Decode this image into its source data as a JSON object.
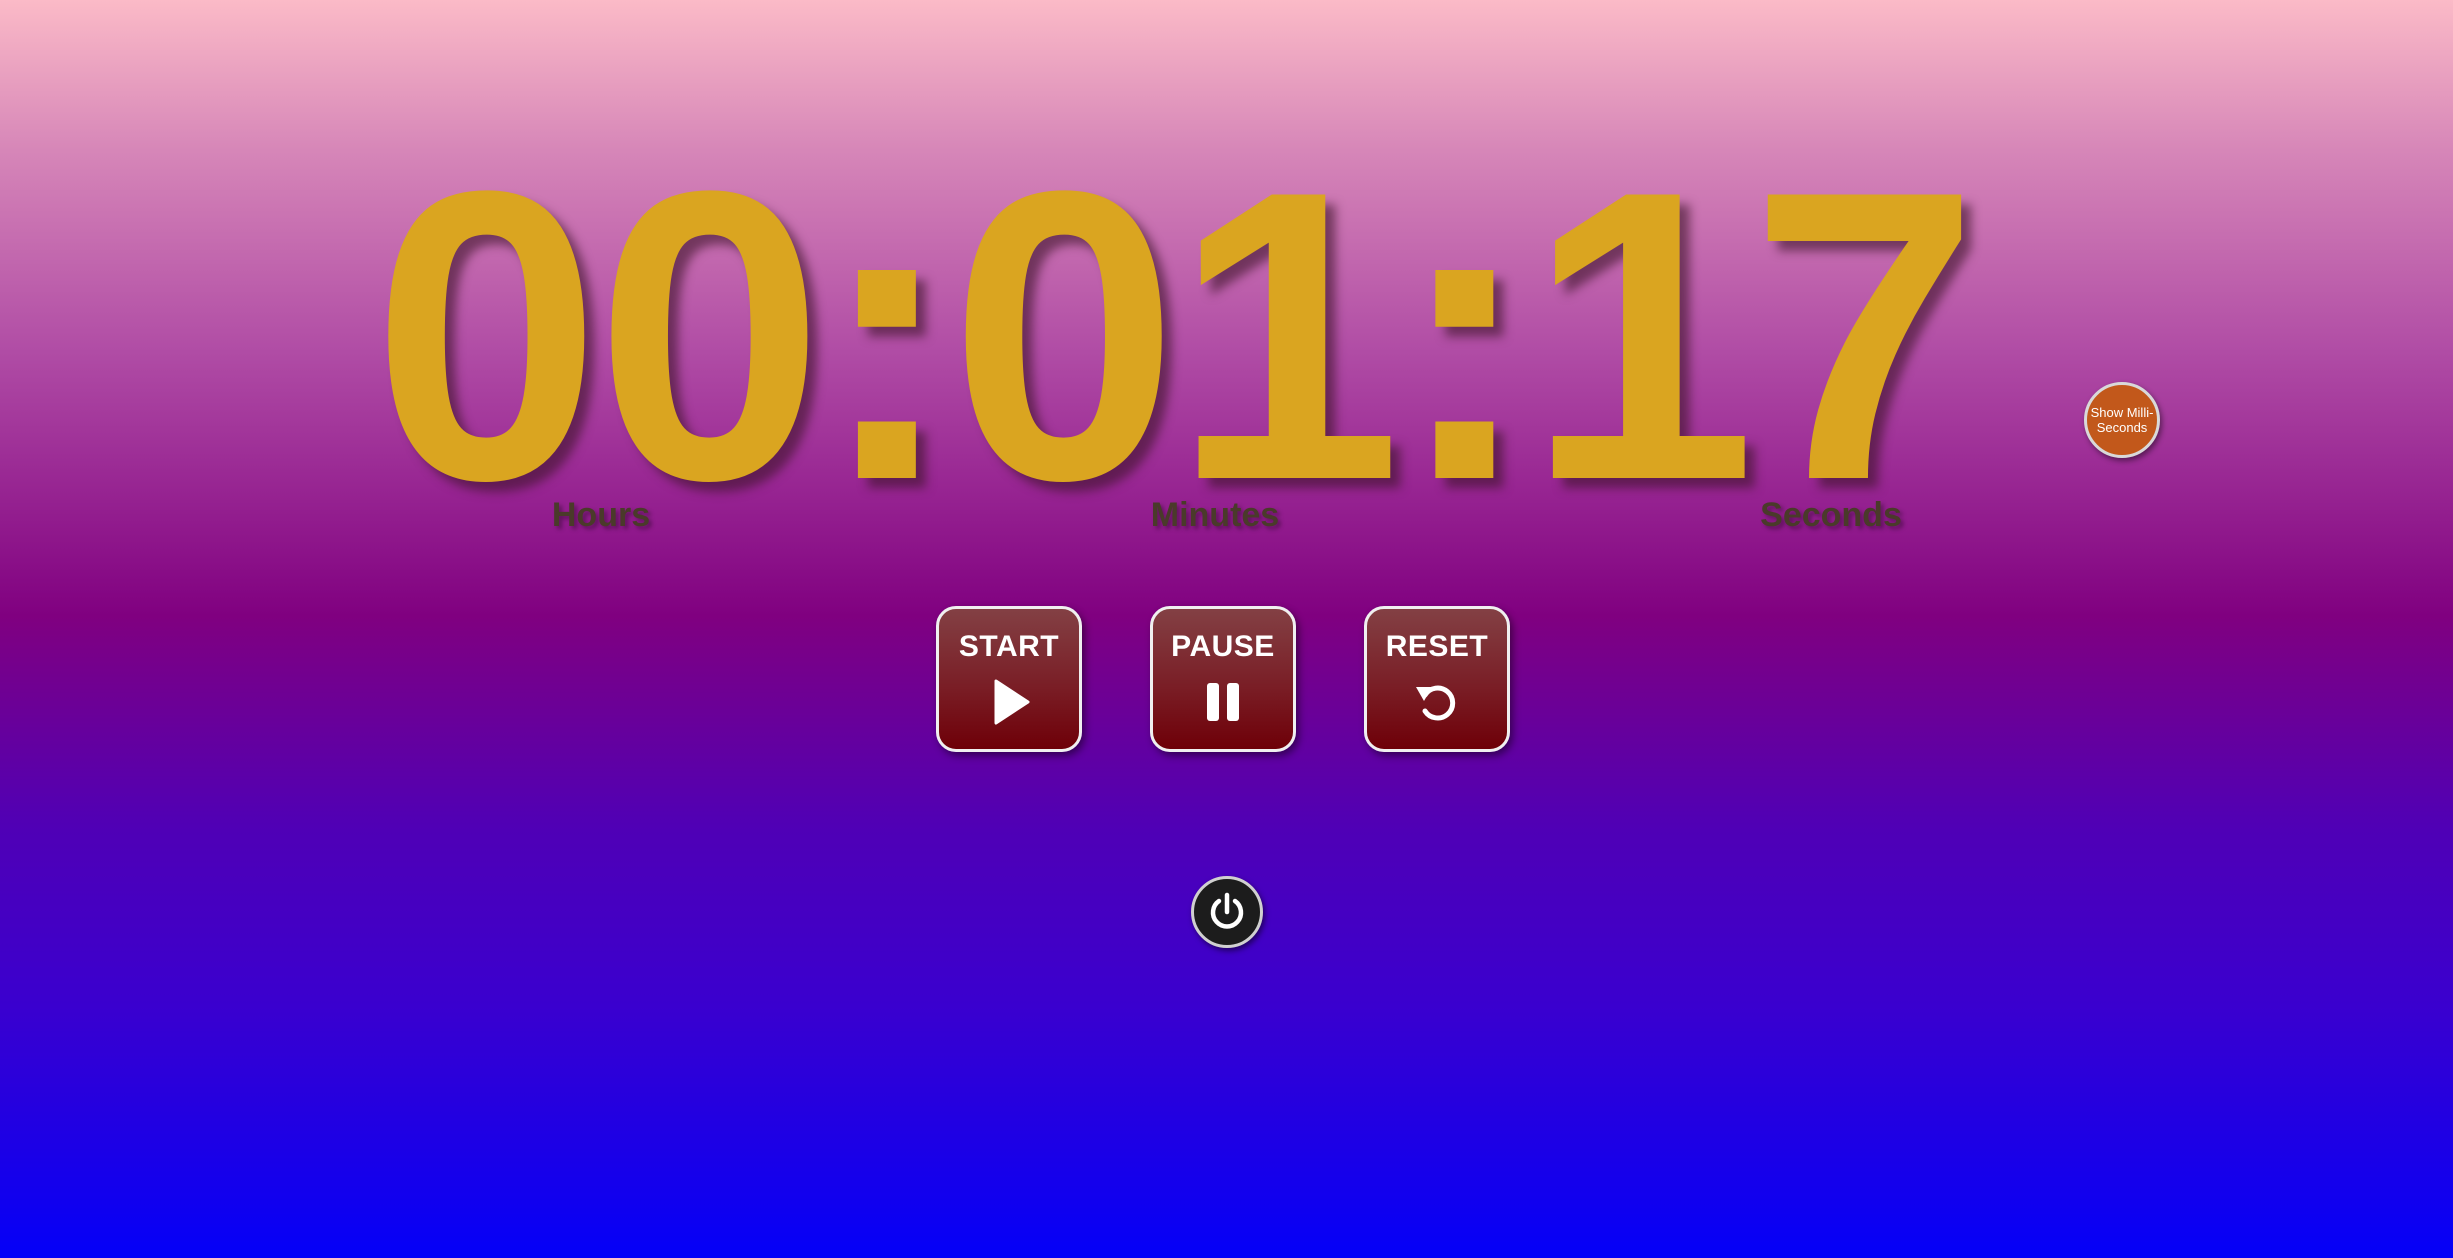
{
  "timer": {
    "display": "00:01:17",
    "hours": "00",
    "minutes": "01",
    "seconds": "17",
    "labels": {
      "hours": "Hours",
      "minutes": "Minutes",
      "seconds": "Seconds"
    }
  },
  "toggle_ms": {
    "label": "Show Milli-Seconds"
  },
  "controls": {
    "start": {
      "label": "START",
      "icon": "play-icon"
    },
    "pause": {
      "label": "PAUSE",
      "icon": "pause-icon"
    },
    "reset": {
      "label": "RESET",
      "icon": "reset-icon"
    }
  },
  "power": {
    "icon": "power-icon"
  },
  "colors": {
    "digits": "#daa520",
    "unit_labels": "#4a3a2a",
    "button_bg": "#7a1e26",
    "toggle_bg": "#c2581b",
    "gradient_top": "#fbbac7",
    "gradient_mid": "#800080",
    "gradient_bottom": "#0400f8"
  }
}
